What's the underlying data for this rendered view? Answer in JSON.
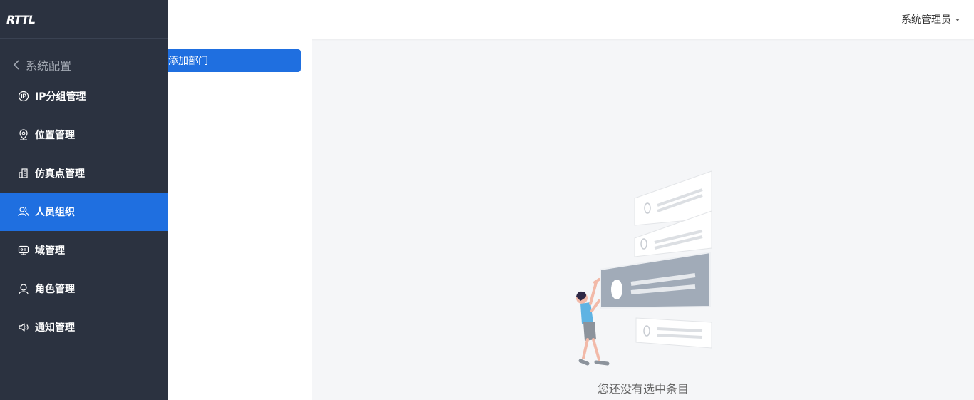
{
  "app": {
    "logo_text": "RTTL"
  },
  "header": {
    "user_name": "系统管理员"
  },
  "sidebar": {
    "back_label": "系统配置",
    "items": [
      {
        "label": "IP分组管理",
        "icon": "ip-icon",
        "active": false
      },
      {
        "label": "位置管理",
        "icon": "location-pin-icon",
        "active": false
      },
      {
        "label": "仿真点管理",
        "icon": "building-icon",
        "active": false
      },
      {
        "label": "人员组织",
        "icon": "users-icon",
        "active": true
      },
      {
        "label": "域管理",
        "icon": "domain-icon",
        "active": false
      },
      {
        "label": "角色管理",
        "icon": "user-icon",
        "active": false
      },
      {
        "label": "通知管理",
        "icon": "speaker-icon",
        "active": false
      }
    ]
  },
  "panel": {
    "add_dept_label": "添加部门"
  },
  "empty_state": {
    "message": "您还没有选中条目"
  },
  "colors": {
    "primary": "#1f6fe0",
    "sidebar_bg": "#2b3240",
    "content_bg": "#f5f6f8"
  }
}
